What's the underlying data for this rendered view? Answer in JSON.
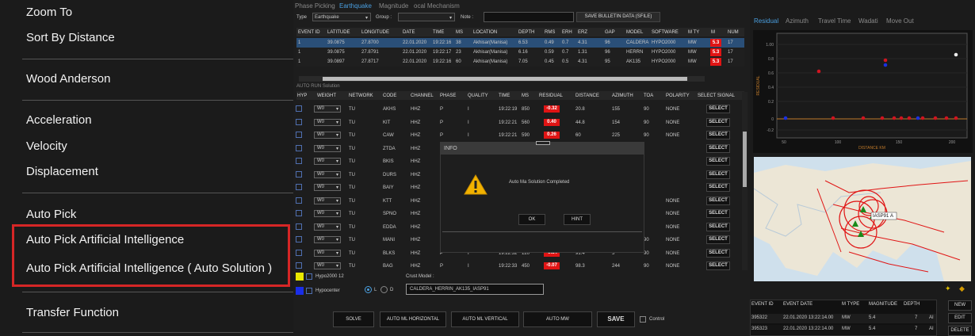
{
  "menu": {
    "items": [
      "Zoom To",
      "Sort By Distance",
      "Wood Anderson",
      "Acceleration",
      "Velocity",
      "Displacement",
      "Auto Pick",
      "Auto Pick Artificial Intelligence",
      "Auto Pick Artificial Intelligence ( Auto Solution )",
      "Transfer Function"
    ]
  },
  "top_tabs": [
    "Phase Picking",
    "Earthquake",
    "Magnitude",
    "ocal Mechanism"
  ],
  "filter": {
    "type_label": "Type",
    "type_value": "Earthquake",
    "group_label": "Group :",
    "note_label": "Note :",
    "save_bulletin": "SAVE BULLETIN DATA (SFILE)"
  },
  "events": {
    "headers": [
      "EVENT ID",
      "LATITUDE",
      "LONGITUDE",
      "DATE",
      "TIME",
      "MS",
      "LOCATION",
      "DEPTH",
      "RMS",
      "ERH",
      "ERZ",
      "GAP",
      "MODEL",
      "SOFTWARE",
      "M TY",
      "M",
      "NUM"
    ],
    "rows": [
      [
        "1",
        "39.0875",
        "27.8700",
        "22.01.2020",
        "19:22:16",
        "38",
        "Akhisar(Manisa)",
        "6.53",
        "0.49",
        "0.7",
        "4.31",
        "96",
        "CALDERA",
        "HYPO2000",
        "MW",
        "5.3",
        "17"
      ],
      [
        "1",
        "39.0875",
        "27.8791",
        "22.01.2020",
        "19:22:17",
        "23",
        "Akhisar(Manisa)",
        "6.16",
        "0.59",
        "0.7",
        "1.31",
        "96",
        "HERRN",
        "HYPO2000",
        "MW",
        "5.3",
        "17"
      ],
      [
        "1",
        "39.0897",
        "27.8717",
        "22.01.2020",
        "19:22:16",
        "60",
        "Akhisar(Manisa)",
        "7.05",
        "0.45",
        "0.5",
        "4.31",
        "95",
        "AK135",
        "HYPO2000",
        "MW",
        "5.3",
        "17"
      ]
    ]
  },
  "auto_sub_label": "AUTO RUN Solution",
  "phases": {
    "headers": [
      "HYP",
      "WEIGHT",
      "NETWORK",
      "CODE",
      "CHANNEL",
      "PHASE",
      "QUALITY",
      "TIME",
      "MS",
      "RESIDUAL",
      "DISTANCE",
      "AZIMUTH",
      "TOA",
      "POLARITY",
      "SELECT SIGNAL"
    ],
    "rows": [
      [
        "W0",
        "TU",
        "AKHS",
        "HHZ",
        "P",
        "I",
        "19:22:19",
        "850",
        "-0.32",
        "20.8",
        "155",
        "90",
        "NONE",
        "SELECT"
      ],
      [
        "W0",
        "TU",
        "KIT",
        "HHZ",
        "P",
        "I",
        "19:22:21",
        "560",
        "0.40",
        "44.8",
        "154",
        "90",
        "NONE",
        "SELECT"
      ],
      [
        "W0",
        "TU",
        "CAW",
        "HHZ",
        "P",
        "I",
        "19:22:21",
        "590",
        "0.26",
        "60",
        "225",
        "90",
        "NONE",
        "SELECT"
      ],
      [
        "W0",
        "TU",
        "ZTDA",
        "HHZ",
        "P",
        "I",
        "",
        "",
        "",
        "",
        "",
        "",
        "",
        "SELECT"
      ],
      [
        "W0",
        "TU",
        "BKIS",
        "HHZ",
        "P",
        "I",
        "",
        "",
        "",
        "",
        "",
        "",
        "",
        "SELECT"
      ],
      [
        "W0",
        "TU",
        "DURS",
        "HHZ",
        "P",
        "I",
        "",
        "",
        "",
        "",
        "",
        "",
        "",
        "SELECT"
      ],
      [
        "W0",
        "TU",
        "BAIY",
        "HHZ",
        "P",
        "I",
        "",
        "",
        "",
        "",
        "",
        "",
        "",
        "SELECT"
      ],
      [
        "W0",
        "TU",
        "KTT",
        "HHZ",
        "P",
        "I",
        "",
        "",
        "",
        "",
        "",
        "",
        "NONE",
        "SELECT"
      ],
      [
        "W0",
        "TU",
        "SPNO",
        "HHZ",
        "P",
        "I",
        "",
        "",
        "",
        "",
        "",
        "",
        "NONE",
        "SELECT"
      ],
      [
        "W0",
        "TU",
        "EDDA",
        "HHZ",
        "P",
        "I",
        "",
        "",
        "",
        "",
        "",
        "",
        "NONE",
        "SELECT"
      ],
      [
        "W0",
        "TU",
        "MANI",
        "HHZ",
        "P",
        "I",
        "19:22:31",
        "760",
        "0.29",
        "86.8",
        "126",
        "90",
        "NONE",
        "SELECT"
      ],
      [
        "W0",
        "TU",
        "BLKS",
        "HHZ",
        "P",
        "I",
        "19:22:32",
        "120",
        "-0.14",
        "91.4",
        "5",
        "90",
        "NONE",
        "SELECT"
      ],
      [
        "W0",
        "TU",
        "BAG",
        "HHZ",
        "P",
        "I",
        "19:22:33",
        "450",
        "-0.07",
        "98.3",
        "244",
        "90",
        "NONE",
        "SELECT"
      ]
    ]
  },
  "dialog": {
    "title": "INFO",
    "message": "Auto Ma Solution Completed",
    "ok": "OK",
    "hint": "HINT"
  },
  "bottom": {
    "hypo_label": "Hypo2000 12",
    "hypocenter": "Hypocenter",
    "crust_label": "Crust Model :",
    "crust_value": "CALDERA_HERRIN_AK135_IASP91",
    "opt_l": "L",
    "opt_d": "D",
    "buttons": [
      "SOLVE",
      "AUTO ML HORIZONTAL",
      "AUTO ML VERTICAL",
      "AUTO MW"
    ],
    "save": "SAVE",
    "control": "Control"
  },
  "right_tabs": [
    "Residual",
    "Azimuth",
    "Travel Time",
    "Wadati",
    "Move Out"
  ],
  "residual_chart": {
    "ylabel": "RESIDUAL",
    "xlabel": "DISTANCE KM",
    "yticks": [
      "1.00",
      "0.8",
      "0.6",
      "0.4",
      "0.2",
      "0",
      "-0.2"
    ],
    "xticks": [
      "50",
      "100",
      "150",
      "200"
    ]
  },
  "map": {
    "label": "IASP91",
    "label2": "A"
  },
  "event_list": {
    "headers": [
      "EVENT ID",
      "EVENT DATE",
      "M TYPE",
      "MAGNITUDE",
      "DEPTH"
    ],
    "rows": [
      [
        "395322",
        "22.01.2020 13:22:14.00",
        "MW",
        "5.4",
        "7",
        "AI"
      ],
      [
        "395323",
        "22.01.2020 13:22:14.00",
        "MW",
        "5.4",
        "7",
        "AI"
      ]
    ],
    "buttons": [
      "NEW",
      "EDIT",
      "DELETE"
    ]
  },
  "colors": {
    "accent": "#4a9fe0",
    "highlight": "#d62626",
    "residual_red": "#e01414"
  }
}
